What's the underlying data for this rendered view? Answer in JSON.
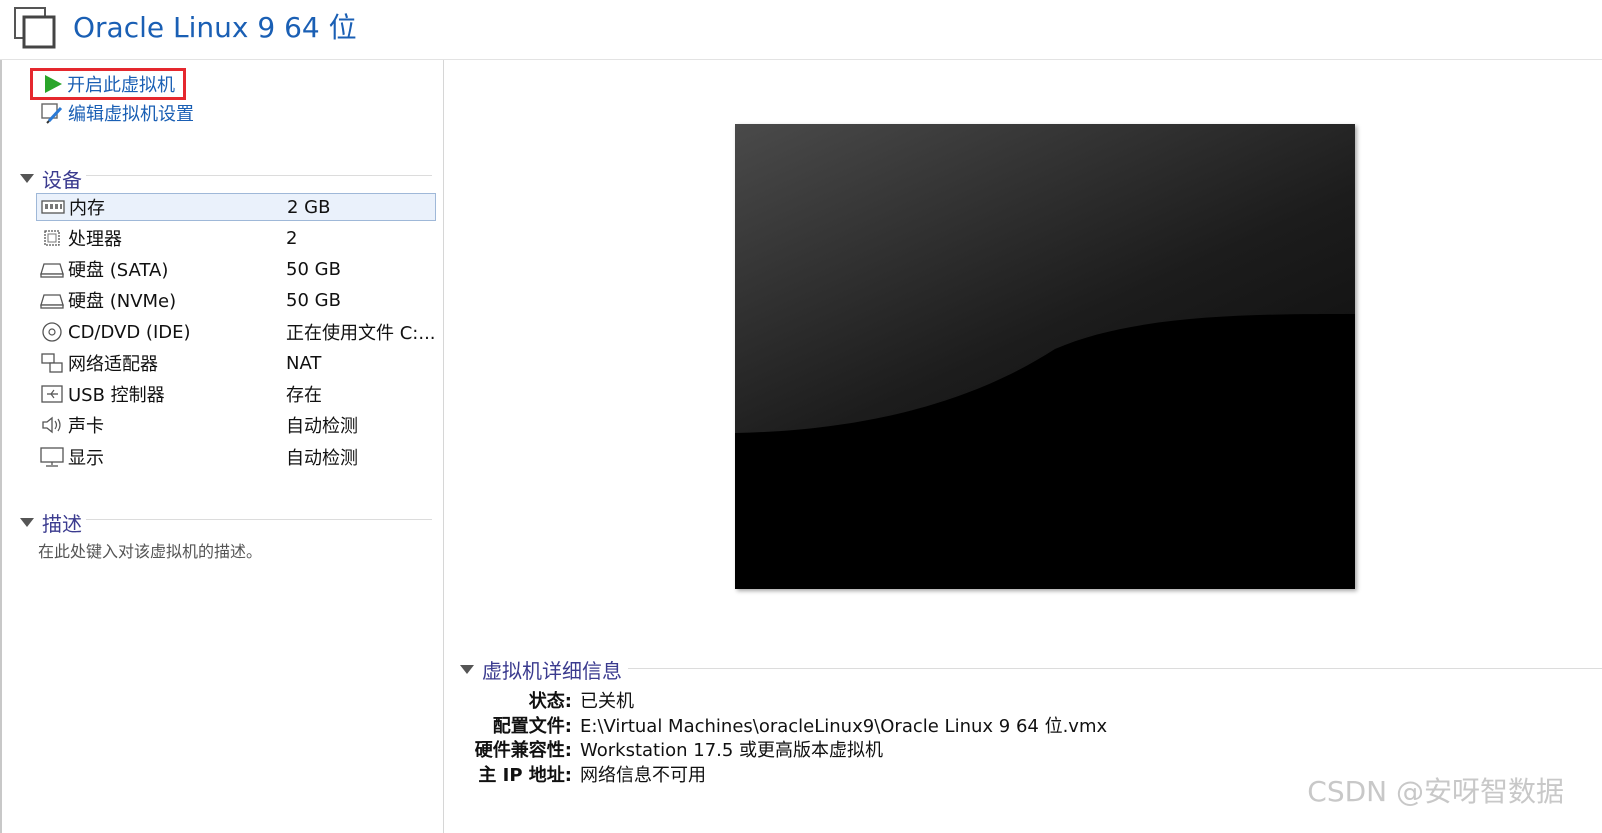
{
  "header": {
    "title": "Oracle Linux 9 64 位",
    "icon": "vm-window-icon"
  },
  "actions": {
    "start_label": "开启此虚拟机",
    "edit_label": "编辑虚拟机设置"
  },
  "devices": {
    "section_label": "设备",
    "items": [
      {
        "name": "内存",
        "value": "2 GB",
        "icon": "memory-icon"
      },
      {
        "name": "处理器",
        "value": "2",
        "icon": "processor-icon"
      },
      {
        "name": "硬盘 (SATA)",
        "value": "50 GB",
        "icon": "hard-disk-icon"
      },
      {
        "name": "硬盘 (NVMe)",
        "value": "50 GB",
        "icon": "hard-disk-icon"
      },
      {
        "name": "CD/DVD (IDE)",
        "value": "正在使用文件 C:...",
        "icon": "cd-dvd-icon"
      },
      {
        "name": "网络适配器",
        "value": "NAT",
        "icon": "network-adapter-icon"
      },
      {
        "name": "USB 控制器",
        "value": "存在",
        "icon": "usb-icon"
      },
      {
        "name": "声卡",
        "value": "自动检测",
        "icon": "speaker-icon"
      },
      {
        "name": "显示",
        "value": "自动检测",
        "icon": "monitor-icon"
      }
    ]
  },
  "description": {
    "section_label": "描述",
    "placeholder": "在此处键入对该虚拟机的描述。"
  },
  "details": {
    "section_label": "虚拟机详细信息",
    "rows": [
      {
        "key": "状态:",
        "value": "已关机"
      },
      {
        "key": "配置文件:",
        "value": "E:\\Virtual Machines\\oracleLinux9\\Oracle Linux 9 64 位.vmx"
      },
      {
        "key": "硬件兼容性:",
        "value": "Workstation 17.5 或更高版本虚拟机"
      },
      {
        "key": "主 IP 地址:",
        "value": "网络信息不可用"
      }
    ]
  },
  "watermark": "CSDN @安呀智数据",
  "colors": {
    "title_blue": "#1a5fb4",
    "section_purple": "#3b3b8f",
    "highlight_red": "#e5282e",
    "play_green": "#2aa52a"
  }
}
